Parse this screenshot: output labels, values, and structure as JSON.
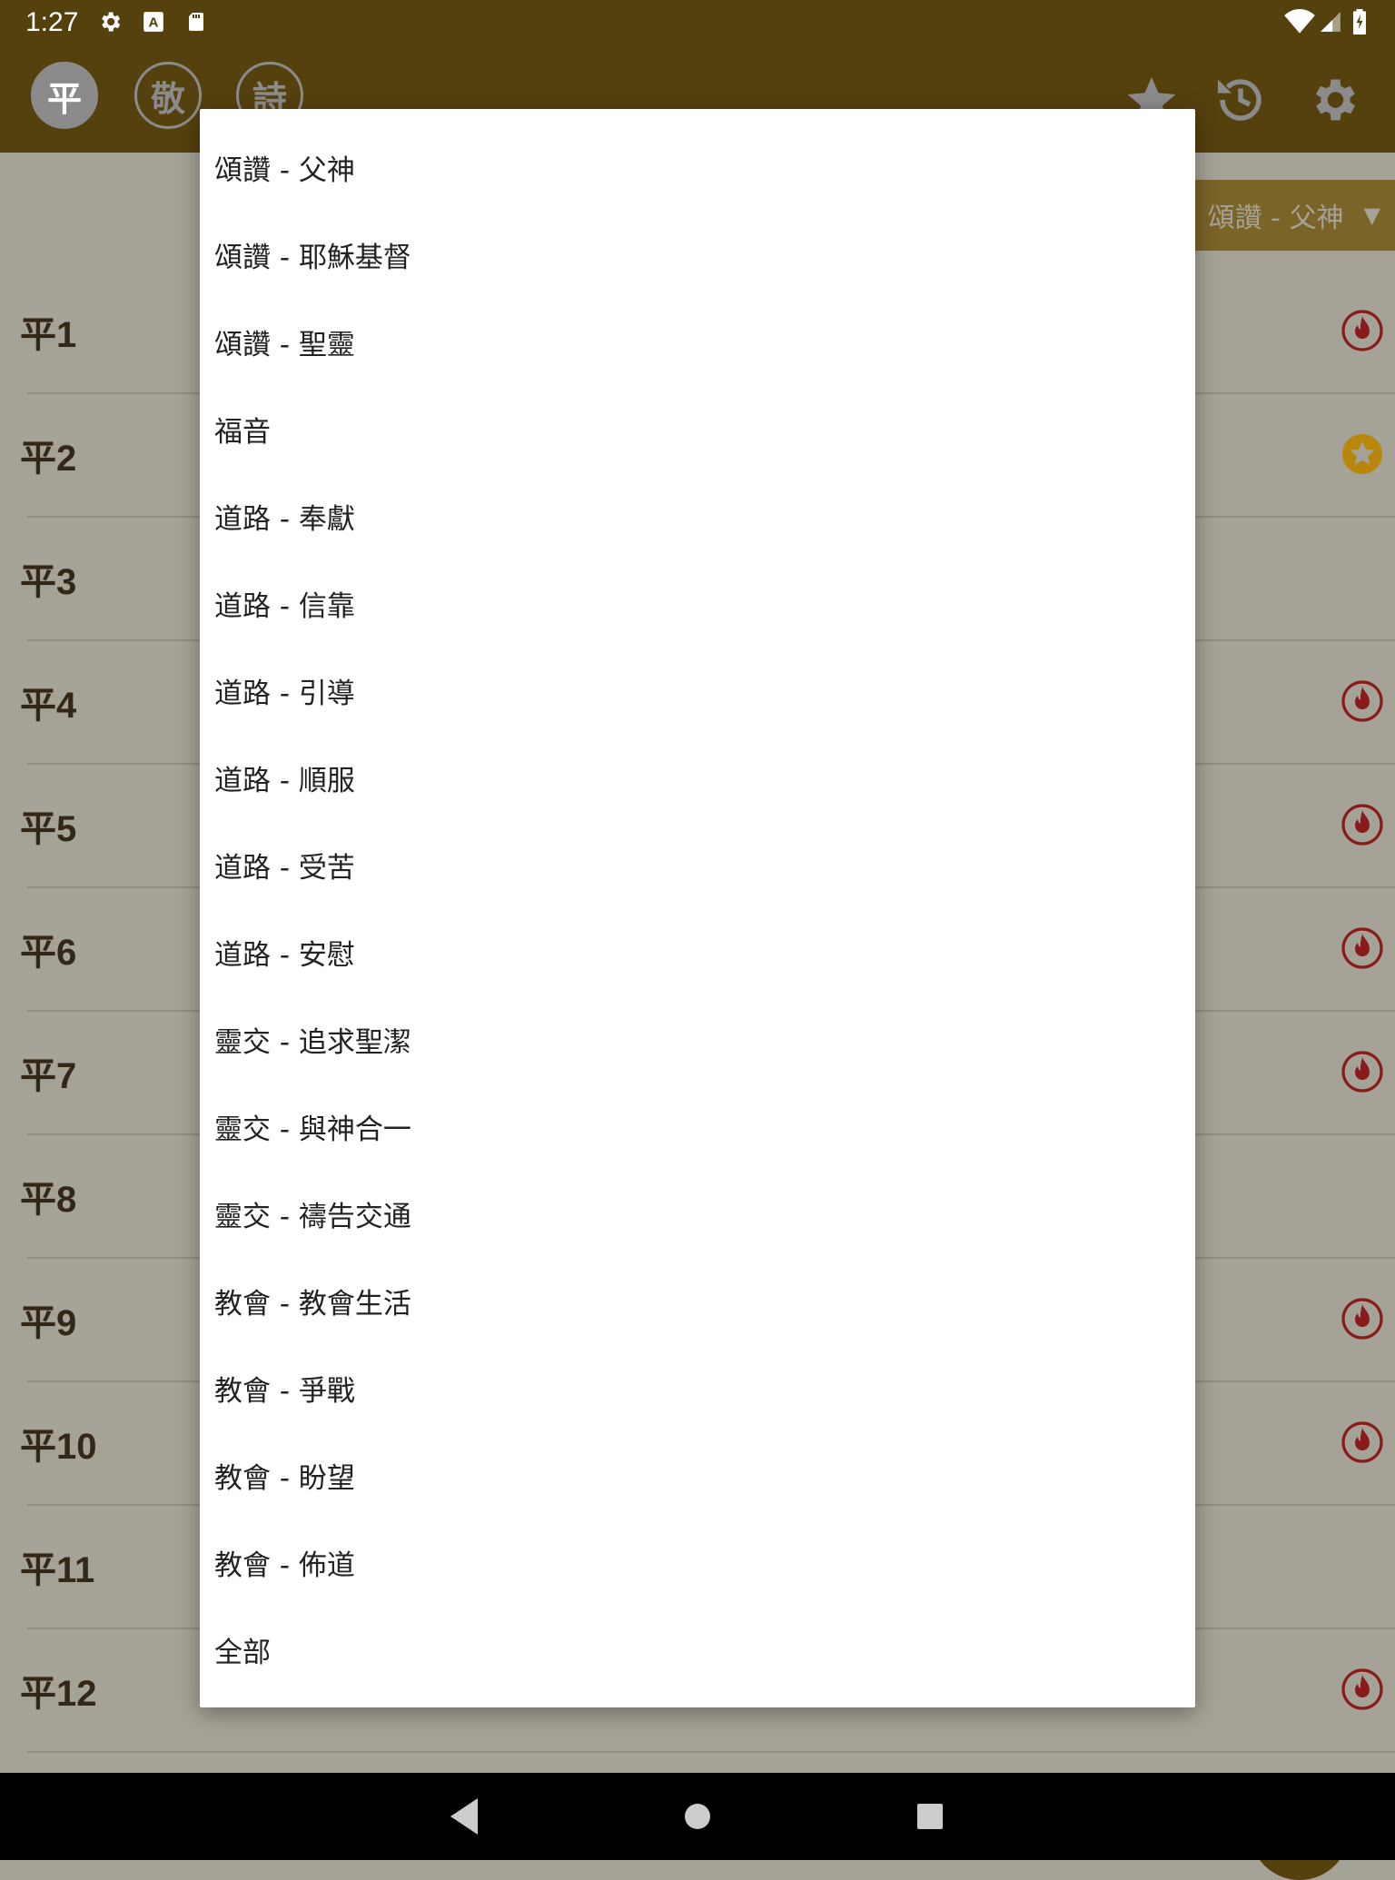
{
  "status": {
    "time": "1:27"
  },
  "tabs": [
    {
      "label": "平",
      "active": true
    },
    {
      "label": "敬",
      "active": false
    },
    {
      "label": "詩",
      "active": false
    }
  ],
  "appbar_icons": [
    "star-icon",
    "history-icon",
    "settings-icon"
  ],
  "filter": {
    "label": "頌讚 - 父神",
    "arrow": "▼"
  },
  "hymns": [
    {
      "label": "平1",
      "badge": "fire"
    },
    {
      "label": "平2",
      "badge": "star"
    },
    {
      "label": "平3",
      "badge": ""
    },
    {
      "label": "平4",
      "badge": "fire"
    },
    {
      "label": "平5",
      "badge": "fire"
    },
    {
      "label": "平6",
      "badge": "fire"
    },
    {
      "label": "平7",
      "badge": "fire"
    },
    {
      "label": "平8",
      "badge": ""
    },
    {
      "label": "平9",
      "badge": "fire"
    },
    {
      "label": "平10",
      "badge": "fire"
    },
    {
      "label": "平11",
      "badge": ""
    },
    {
      "label": "平12",
      "badge": "fire"
    }
  ],
  "dialog": {
    "options": [
      "頌讚 - 父神",
      "頌讚 - 耶穌基督",
      "頌讚 - 聖靈",
      "福音",
      "道路 - 奉獻",
      "道路 - 信靠",
      "道路 - 引導",
      "道路 - 順服",
      "道路 - 受苦",
      "道路 - 安慰",
      "靈交 - 追求聖潔",
      "靈交 - 與神合一",
      "靈交 - 禱告交通",
      "教會 - 教會生活",
      "教會 - 爭戰",
      "教會 - 盼望",
      "教會 - 佈道",
      "全部"
    ]
  },
  "colors": {
    "appbar": "#55410e",
    "scrim_bg": "#a5a297",
    "fire": "#8a1b1b",
    "star_badge": "#b8860b"
  }
}
